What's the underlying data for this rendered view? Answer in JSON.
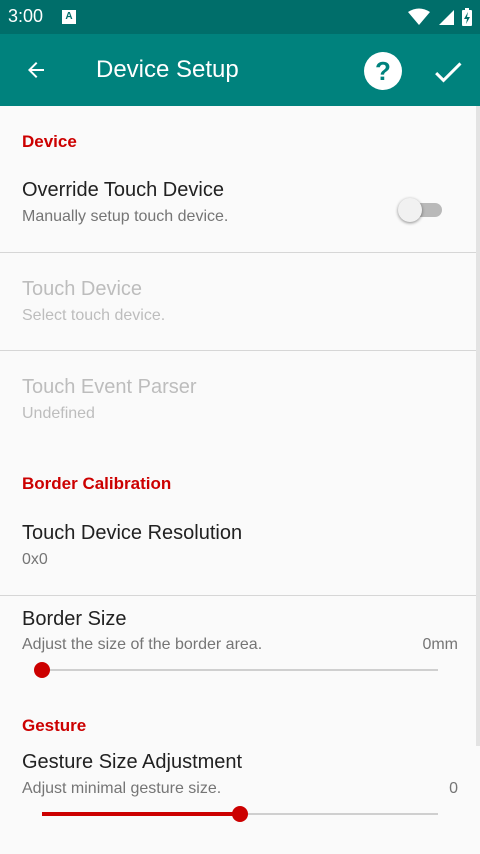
{
  "status_bar": {
    "time": "3:00",
    "notification": "A"
  },
  "app_bar": {
    "title": "Device Setup",
    "help_label": "?"
  },
  "sections": {
    "device": {
      "header": "Device",
      "override": {
        "title": "Override Touch Device",
        "summary": "Manually setup touch device.",
        "enabled": false
      },
      "touch_device": {
        "title": "Touch Device",
        "summary": "Select touch device."
      },
      "event_parser": {
        "title": "Touch Event Parser",
        "summary": "Undefined"
      }
    },
    "border": {
      "header": "Border Calibration",
      "resolution": {
        "title": "Touch Device Resolution",
        "summary": "0x0"
      },
      "border_size": {
        "title": "Border Size",
        "summary": "Adjust the size of the border area.",
        "value_label": "0mm",
        "slider_fraction": 0
      }
    },
    "gesture": {
      "header": "Gesture",
      "size_adjustment": {
        "title": "Gesture Size Adjustment",
        "summary": "Adjust minimal gesture size.",
        "value_label": "0",
        "slider_fraction": 0.5
      }
    }
  },
  "colors": {
    "status_bar": "#006e6a",
    "app_bar": "#00827d",
    "accent": "#cc0000"
  }
}
